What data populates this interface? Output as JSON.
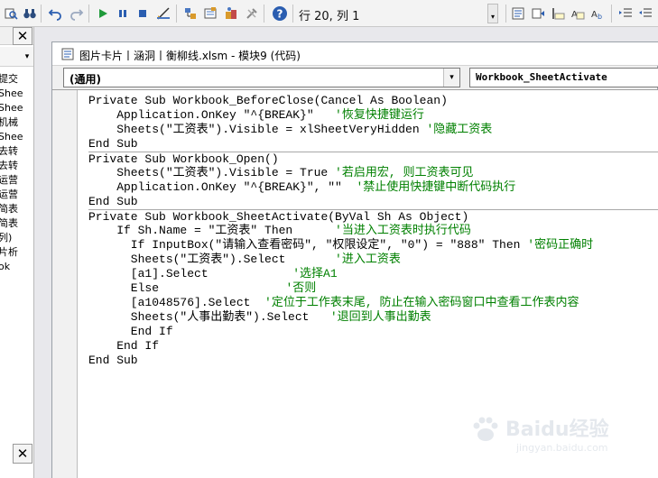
{
  "toolbar": {
    "status": "行 20, 列 1"
  },
  "left_pane": {
    "items": [
      "提交",
      "Shee",
      "Shee",
      "机械",
      "Shee",
      "去转",
      "去转",
      "运营",
      "运营",
      "简表",
      "简表",
      "列)",
      "片析",
      "ok"
    ]
  },
  "code_window": {
    "title": "图片卡片丨涵洞丨衡柳线.xlsm - 模块9 (代码)",
    "object_combo": "(通用)",
    "proc_combo": "Workbook_SheetActivate"
  },
  "code_lines": [
    {
      "code": "Private Sub Workbook_BeforeClose(Cancel As Boolean)",
      "comment": ""
    },
    {
      "code": "    Application.OnKey \"^{BREAK}\"   ",
      "comment": "'恢复快捷键运行"
    },
    {
      "code": "    Sheets(\"工资表\").Visible = xlSheetVeryHidden ",
      "comment": "'隐藏工资表"
    },
    {
      "code": "End Sub",
      "comment": ""
    },
    {
      "code": "Private Sub Workbook_Open()",
      "comment": ""
    },
    {
      "code": "    Sheets(\"工资表\").Visible = True ",
      "comment": "'若启用宏, 则工资表可见"
    },
    {
      "code": "    Application.OnKey \"^{BREAK}\", \"\"  ",
      "comment": "'禁止使用快捷键中断代码执行"
    },
    {
      "code": "End Sub",
      "comment": ""
    },
    {
      "code": "Private Sub Workbook_SheetActivate(ByVal Sh As Object)",
      "comment": ""
    },
    {
      "code": "    If Sh.Name = \"工资表\" Then      ",
      "comment": "'当进入工资表时执行代码"
    },
    {
      "code": "      If InputBox(\"请输入查看密码\", \"权限设定\", \"0\") = \"888\" Then ",
      "comment": "'密码正确时"
    },
    {
      "code": "      Sheets(\"工资表\").Select       ",
      "comment": "'进入工资表"
    },
    {
      "code": "      [a1].Select            ",
      "comment": "'选择A1"
    },
    {
      "code": "      Else                  ",
      "comment": "'否则"
    },
    {
      "code": "      [a1048576].Select  ",
      "comment": "'定位于工作表末尾, 防止在输入密码窗口中查看工作表内容"
    },
    {
      "code": "      Sheets(\"人事出勤表\").Select   ",
      "comment": "'退回到人事出勤表"
    },
    {
      "code": "      End If",
      "comment": ""
    },
    {
      "code": "    End If",
      "comment": ""
    },
    {
      "code": "End Sub",
      "comment": ""
    }
  ],
  "watermark": {
    "main": "Baidu经验",
    "sub": "jingyan.baidu.com"
  },
  "colors": {
    "comment": "#008000",
    "code": "#000000"
  }
}
